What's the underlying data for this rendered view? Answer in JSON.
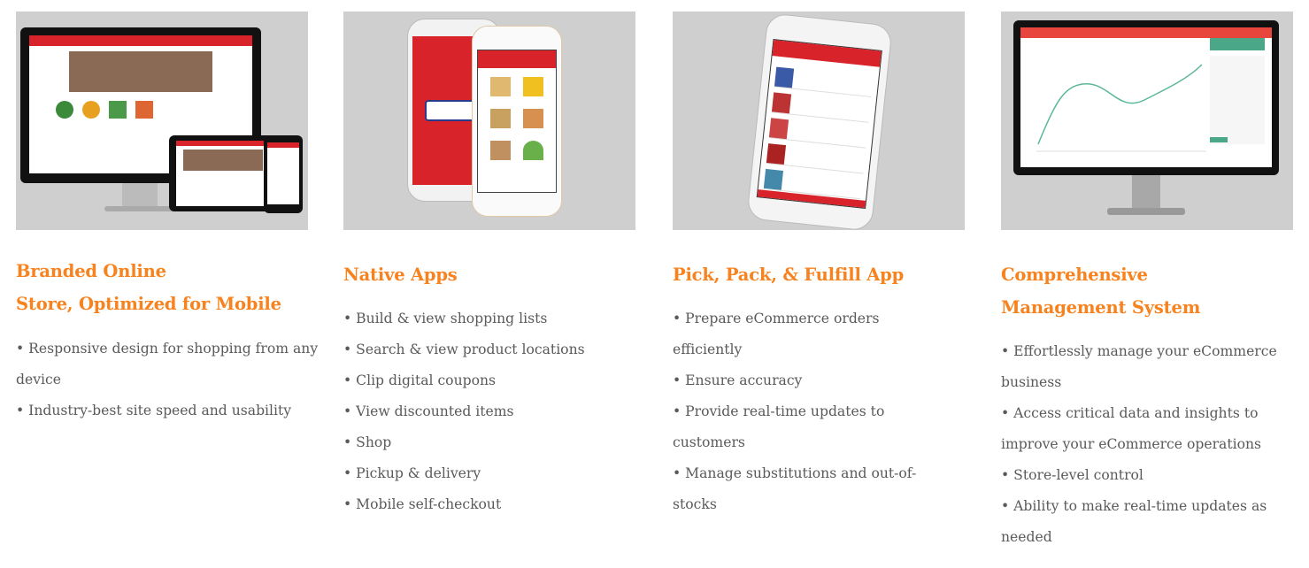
{
  "colors": {
    "heading": "#f7821e",
    "body_text": "#5a5a5a",
    "image_bg": "#cfcfcf",
    "brand_red": "#d9232a"
  },
  "features": [
    {
      "title_lines": [
        "Branded Online",
        "Store, Optimized for Mobile"
      ],
      "image": "responsive-devices-mockup",
      "bullets": [
        "Responsive design for shopping from any device",
        "Industry-best site speed and usability"
      ]
    },
    {
      "title_lines": [
        "Native Apps"
      ],
      "image": "native-app-phones-mockup",
      "bullets": [
        "Build & view shopping lists",
        "Search & view product locations",
        "Clip digital coupons",
        "View discounted items",
        "Shop",
        "Pickup & delivery",
        "Mobile self-checkout"
      ]
    },
    {
      "title_lines": [
        "Pick, Pack, & Fulfill App"
      ],
      "image": "picker-app-phone-mockup",
      "bullets": [
        "Prepare eCommerce orders efficiently",
        "Ensure accuracy",
        "Provide real-time updates to customers",
        "Manage substitutions and out-of-stocks"
      ]
    },
    {
      "title_lines": [
        "Comprehensive",
        "Management System"
      ],
      "image": "management-dashboard-monitor-mockup",
      "bullets": [
        "Effortlessly manage your eCommerce business",
        "Access critical data and insights to improve your eCommerce operations",
        "Store-level control",
        "Ability to make real-time updates as needed"
      ]
    }
  ]
}
